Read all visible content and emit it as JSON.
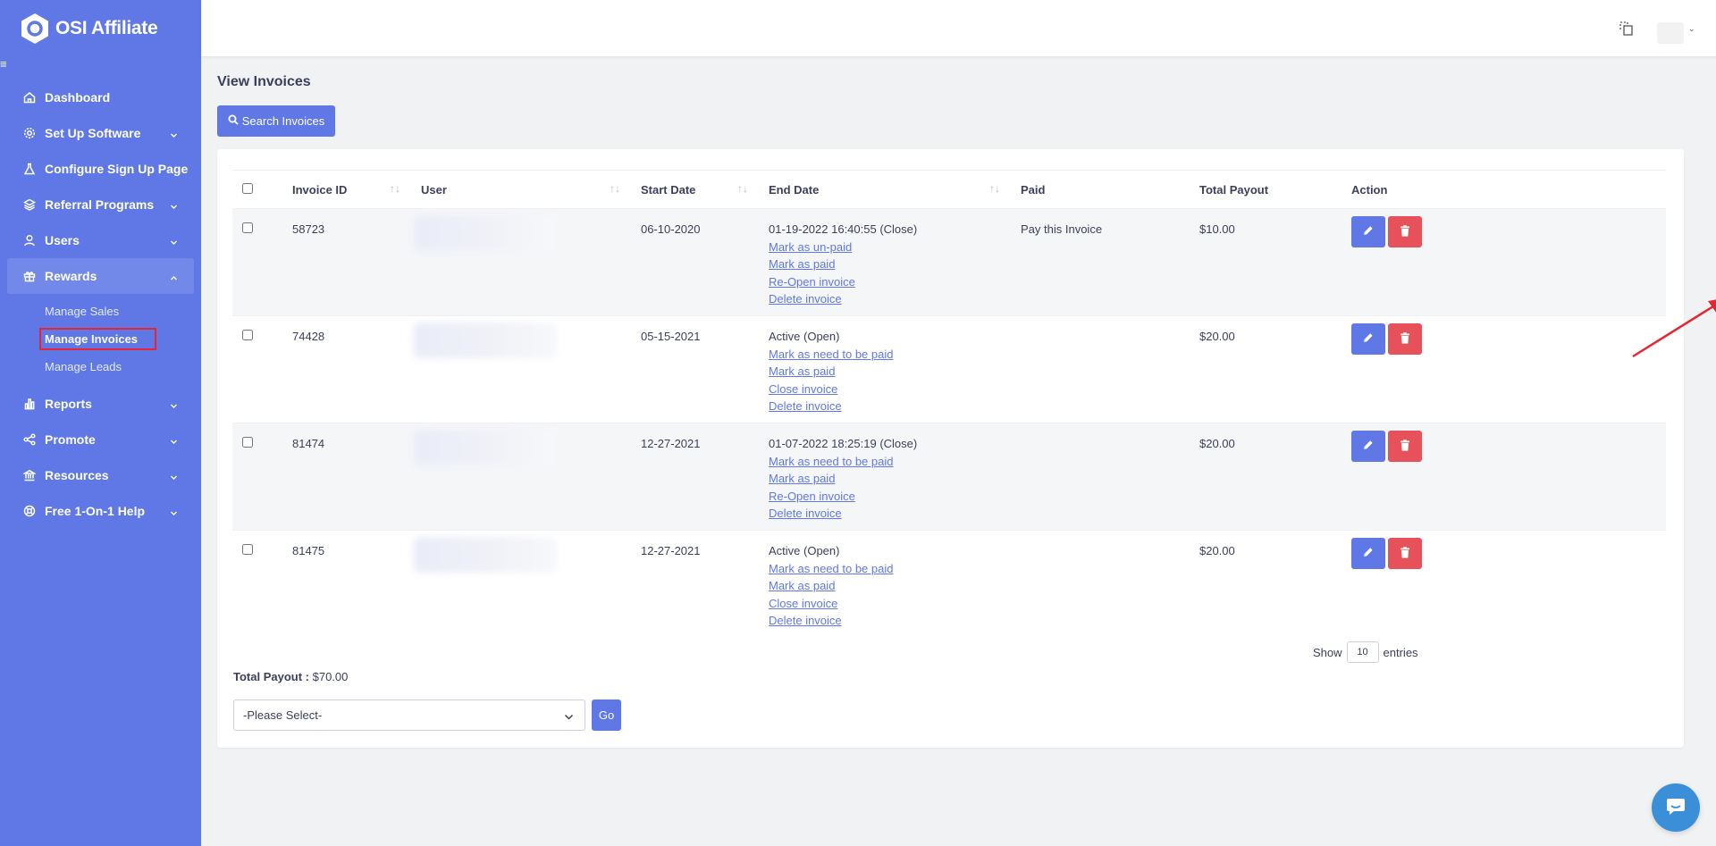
{
  "app": {
    "name": "OSI Affiliate"
  },
  "sidebar": {
    "items": [
      {
        "label": "Dashboard",
        "icon": "home-icon",
        "has_children": false
      },
      {
        "label": "Set Up Software",
        "icon": "gear-icon",
        "has_children": true
      },
      {
        "label": "Configure Sign Up Page",
        "icon": "flask-icon",
        "has_children": false
      },
      {
        "label": "Referral Programs",
        "icon": "layers-icon",
        "has_children": true
      },
      {
        "label": "Users",
        "icon": "user-icon",
        "has_children": true
      },
      {
        "label": "Rewards",
        "icon": "gift-icon",
        "has_children": true,
        "expanded": true
      },
      {
        "label": "Reports",
        "icon": "bar-chart-icon",
        "has_children": true
      },
      {
        "label": "Promote",
        "icon": "share-icon",
        "has_children": true
      },
      {
        "label": "Resources",
        "icon": "bank-icon",
        "has_children": true
      },
      {
        "label": "Free 1-On-1 Help",
        "icon": "lifebuoy-icon",
        "has_children": true
      }
    ],
    "rewards_sub": [
      "Manage Sales",
      "Manage Invoices",
      "Manage Leads"
    ],
    "current_sub": "Manage Invoices"
  },
  "page": {
    "title": "View Invoices",
    "search_button": "Search Invoices"
  },
  "table": {
    "columns": [
      "Invoice ID",
      "User",
      "Start Date",
      "End Date",
      "Paid",
      "Total Payout",
      "Action"
    ],
    "rows": [
      {
        "id": "58723",
        "start": "06-10-2020",
        "status": "01-19-2022 16:40:55 (Close)",
        "links": [
          "Mark as un-paid",
          "Mark as paid",
          "Re-Open invoice",
          "Delete invoice"
        ],
        "paid": "Pay this Invoice",
        "payout": "$10.00"
      },
      {
        "id": "74428",
        "start": "05-15-2021",
        "status": "Active (Open)",
        "links": [
          "Mark as need to be paid",
          "Mark as paid",
          "Close invoice",
          "Delete invoice"
        ],
        "paid": "",
        "payout": "$20.00"
      },
      {
        "id": "81474",
        "start": "12-27-2021",
        "status": "01-07-2022 18:25:19 (Close)",
        "links": [
          "Mark as need to be paid",
          "Mark as paid",
          "Re-Open invoice",
          "Delete invoice"
        ],
        "paid": "",
        "payout": "$20.00"
      },
      {
        "id": "81475",
        "start": "12-27-2021",
        "status": "Active (Open)",
        "links": [
          "Mark as need to be paid",
          "Mark as paid",
          "Close invoice",
          "Delete invoice"
        ],
        "paid": "",
        "payout": "$20.00"
      }
    ]
  },
  "pagination": {
    "show_label": "Show",
    "entries_value": "10",
    "entries_label": "entries"
  },
  "summary": {
    "total_label": "Total Payout :",
    "total_value": "$70.00"
  },
  "bulk": {
    "select_placeholder": "-Please Select-",
    "go_label": "Go"
  },
  "colors": {
    "brand": "#5f78e6",
    "danger": "#e7515a",
    "annotation": "#e52531",
    "chat": "#3a8fd8"
  }
}
